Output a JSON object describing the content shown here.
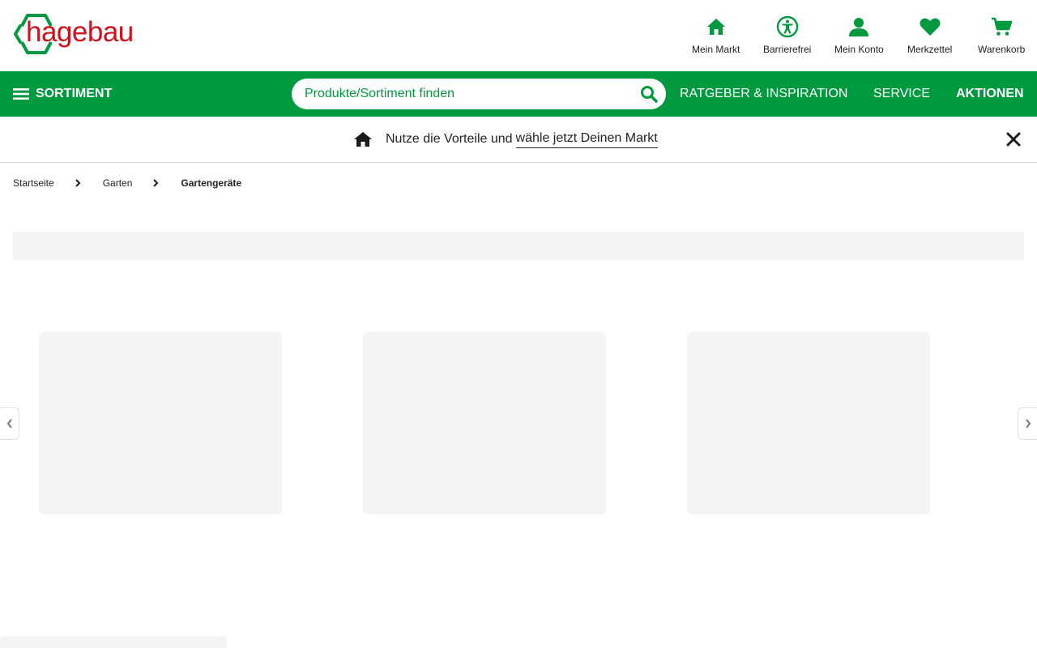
{
  "brand": {
    "logo_text": "hagebau",
    "primary_color": "#009a3e",
    "logo_color": "#d0111b"
  },
  "header": {
    "icons": [
      {
        "label": "Mein Markt",
        "icon": "home-icon"
      },
      {
        "label": "Barrierefrei",
        "icon": "accessibility-icon"
      },
      {
        "label": "Mein Konto",
        "icon": "user-icon"
      },
      {
        "label": "Merkzettel",
        "icon": "heart-icon"
      },
      {
        "label": "Warenkorb",
        "icon": "cart-icon"
      }
    ]
  },
  "nav": {
    "sortiment_label": "SORTIMENT",
    "search_placeholder": "Produkte/Sortiment finden",
    "links": [
      "RATGEBER & INSPIRATION",
      "SERVICE",
      "AKTIONEN"
    ]
  },
  "banner": {
    "text": "Nutze die Vorteile und",
    "link_text": "wähle jetzt Deinen Markt"
  },
  "breadcrumb": [
    "Startseite",
    "Garten",
    "Gartengeräte"
  ]
}
